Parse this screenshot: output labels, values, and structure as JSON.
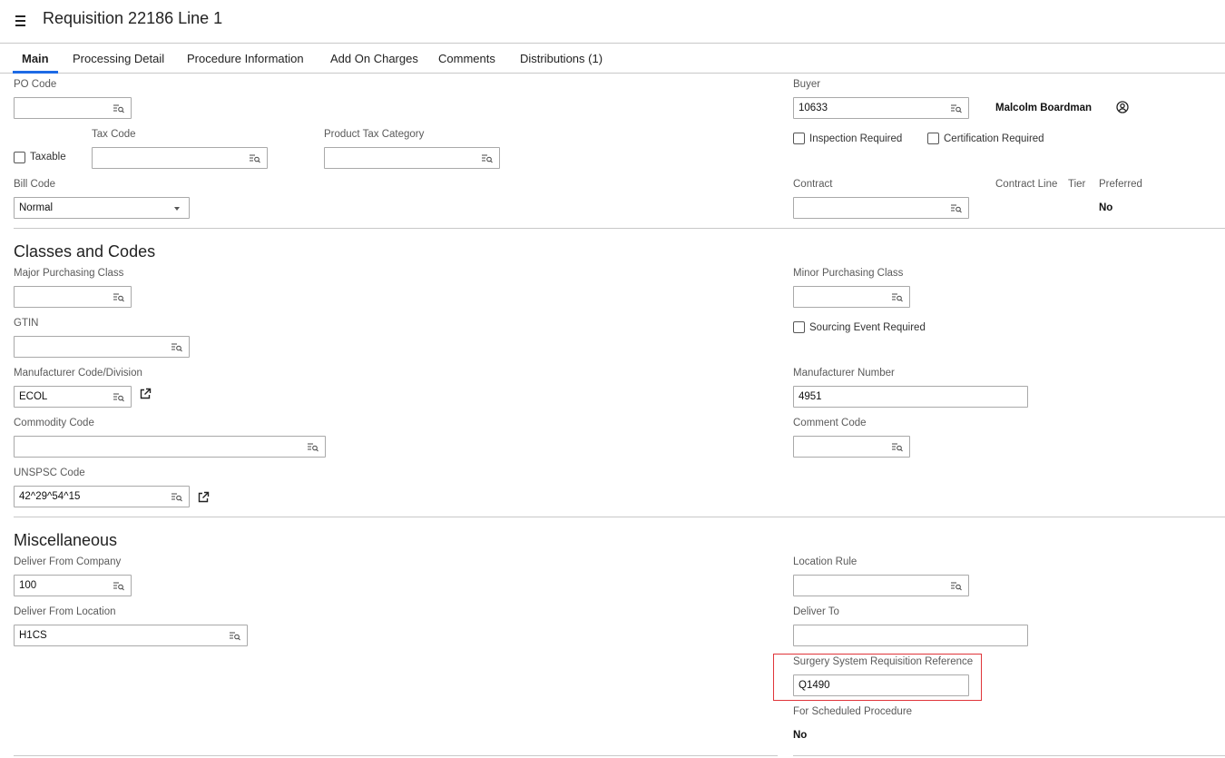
{
  "header": {
    "title": "Requisition 22186 Line 1",
    "menu_icon": "hamburger-menu-icon"
  },
  "tabs": [
    {
      "label": "Main",
      "active": true
    },
    {
      "label": "Processing Detail"
    },
    {
      "label": "Procedure Information"
    },
    {
      "label": "Add On Charges"
    },
    {
      "label": "Comments"
    },
    {
      "label": "Distributions (1)"
    }
  ],
  "main": {
    "po_code": {
      "label": "PO Code",
      "value": ""
    },
    "taxable": {
      "label": "Taxable",
      "checked": false
    },
    "tax_code": {
      "label": "Tax Code",
      "value": ""
    },
    "product_tax_category": {
      "label": "Product Tax Category",
      "value": ""
    },
    "bill_code": {
      "label": "Bill Code",
      "value": "Normal"
    },
    "buyer": {
      "label": "Buyer",
      "value": "10633",
      "name": "Malcolm Boardman"
    },
    "inspection_required": {
      "label": "Inspection Required",
      "checked": false
    },
    "certification_required": {
      "label": "Certification Required",
      "checked": false
    },
    "contract": {
      "label": "Contract",
      "value": ""
    },
    "contract_line": {
      "label": "Contract Line"
    },
    "tier": {
      "label": "Tier"
    },
    "preferred": {
      "label": "Preferred",
      "value": "No"
    }
  },
  "classes": {
    "title": "Classes and Codes",
    "major_purchasing_class": {
      "label": "Major Purchasing Class",
      "value": ""
    },
    "minor_purchasing_class": {
      "label": "Minor Purchasing Class",
      "value": ""
    },
    "gtin": {
      "label": "GTIN",
      "value": ""
    },
    "sourcing_event_required": {
      "label": "Sourcing Event Required",
      "checked": false
    },
    "manufacturer_code": {
      "label": "Manufacturer Code/Division",
      "value": "ECOL"
    },
    "manufacturer_number": {
      "label": "Manufacturer Number",
      "value": "4951"
    },
    "commodity_code": {
      "label": "Commodity Code",
      "value": ""
    },
    "comment_code": {
      "label": "Comment Code",
      "value": ""
    },
    "unspsc_code": {
      "label": "UNSPSC Code",
      "value": "42^29^54^15"
    }
  },
  "misc": {
    "title": "Miscellaneous",
    "deliver_from_company": {
      "label": "Deliver From Company",
      "value": "100"
    },
    "location_rule": {
      "label": "Location Rule",
      "value": ""
    },
    "deliver_from_location": {
      "label": "Deliver From Location",
      "value": "H1CS"
    },
    "deliver_to": {
      "label": "Deliver To",
      "value": ""
    },
    "surgery_ref": {
      "label": "Surgery System Requisition Reference",
      "value": "Q1490"
    },
    "for_scheduled_procedure": {
      "label": "For Scheduled Procedure",
      "value": "No"
    }
  },
  "colors": {
    "accent": "#1d6ae5",
    "highlight": "#e0353a"
  }
}
